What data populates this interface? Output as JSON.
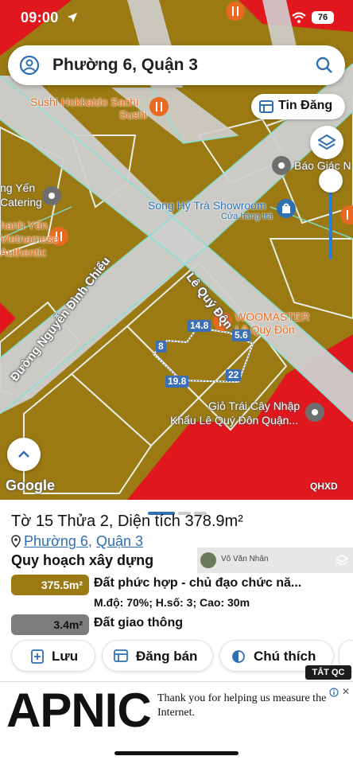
{
  "status_bar": {
    "time": "09:00",
    "battery": "76"
  },
  "search": {
    "query": "Phường 6, Quận 3"
  },
  "map": {
    "tin_dang_label": "Tin Đăng",
    "google_label": "Google",
    "qhxd_label": "QHXD",
    "roads": {
      "le_quy_don": "Lê Quý Đôn",
      "nguyen_dinh_chieu": "Đường Nguyễn Đình Chiểu"
    },
    "pois": {
      "sushi": "Sushi Hokkaido Sachi",
      "sushi_line2": "Sushi",
      "catering": "ng Yến",
      "catering_line2": "Catering",
      "restaurant": "hanh Yến",
      "restaurant_line2": "Vietnamese",
      "restaurant_line3": "Authentic",
      "song_hy": "Song Hỷ Trà Showroom",
      "song_hy_sub": "Cửa hàng trà",
      "bao_giac": "Báo Giác N",
      "woomaster": "WOOMASTER",
      "woomaster_line2": "Lê Quý Đôn",
      "gio_trai_cay": "Giỏ Trái Cây Nhập",
      "gio_trai_cay_line2": "Khẩu Lê Quý Đôn Quận..."
    },
    "dimensions": {
      "top": "14.8",
      "top_right": "5.6",
      "left": "8",
      "bottom": "19.8",
      "right": "22"
    }
  },
  "sheet": {
    "title": "Tờ 15 Thửa 2, Diện tích 378.9m²",
    "ward": "Phường 6",
    "district": "Quận 3",
    "separator": ",",
    "planning_heading": "Quy hoạch xây dựng",
    "overlay_user": "Võ Văn Nhân",
    "zones": [
      {
        "area": "375.5m²",
        "name": "Đất phức hợp - chủ đạo chức nă...",
        "params": "M.độ: 70%; H.số: 3; Cao: 30m",
        "color": "#9b7a14"
      },
      {
        "area": "3.4m²",
        "name": "Đất giao thông",
        "color": "#7d7d7d"
      }
    ],
    "buttons": {
      "save": "Lưu",
      "sell": "Đăng bán",
      "legend": "Chú thích"
    },
    "tat_qc": "TẮT QC"
  },
  "ad": {
    "logo": "APNIC",
    "message": "Thank you for helping us measure the Internet."
  },
  "colors": {
    "parcel": "#9b7a14",
    "road": "#cfcfcf",
    "red_zone": "#e0171d",
    "accent": "#2f6fb3"
  }
}
